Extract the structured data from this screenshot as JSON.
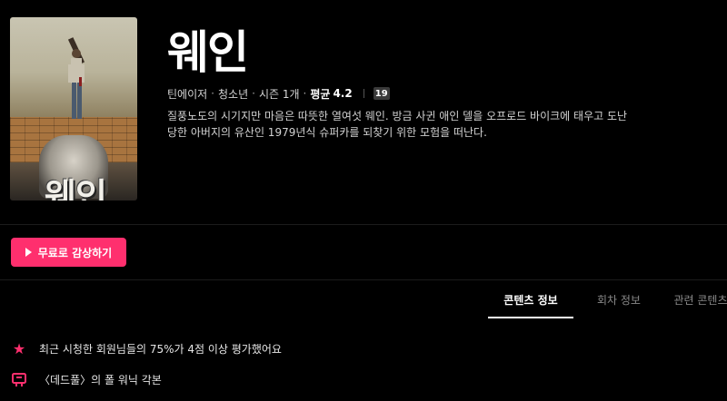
{
  "show": {
    "title": "웨인",
    "poster_title": "웨인",
    "meta": {
      "genre": "틴에이저",
      "category": "청소년",
      "seasons": "시즌 1개",
      "rating_label": "평균",
      "rating_value": "4.2",
      "age_badge": "19"
    },
    "synopsis": "질풍노도의 시기지만 마음은 따뜻한 열여섯 웨인. 방금 사귄 애인 델을 오프로드 바이크에 태우고 도난당한 아버지의 유산인 1979년식 슈퍼카를 되찾기 위한 모험을 떠난다."
  },
  "actions": {
    "watch_label": "무료로 감상하기"
  },
  "tabs": [
    {
      "label": "콘텐츠 정보",
      "active": true
    },
    {
      "label": "회차 정보",
      "active": false
    },
    {
      "label": "관련 콘텐츠",
      "active": false
    }
  ],
  "info": {
    "rating_stat": "최근 시청한 회원님들의 75%가 4점 이상 평가했어요",
    "origin": "〈데드풀〉의 폴 워닉 각본"
  },
  "colors": {
    "accent": "#ff2f6e",
    "background": "#000000"
  },
  "icons": {
    "play": "play-icon",
    "star": "star-icon",
    "origin": "film-credit-icon"
  }
}
